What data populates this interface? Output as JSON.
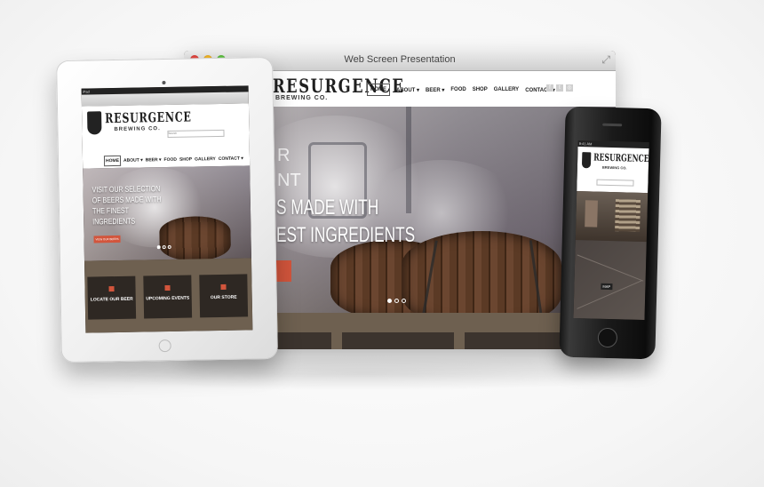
{
  "browser": {
    "window_title": "Web Screen Presentation",
    "traffic_lights": {
      "close": "#e2463f",
      "minimize": "#f0b429",
      "maximize": "#5cbf3f"
    },
    "site": {
      "logo_main": "RESURGENCE",
      "logo_sub": "BREWING CO.",
      "nav": [
        "HOME",
        "ABOUT ▾",
        "BEER ▾",
        "FOOD",
        "SHOP",
        "GALLERY",
        "CONTACT ▾"
      ],
      "social_icons": [
        "facebook-icon",
        "twitter-icon",
        "instagram-icon"
      ],
      "hero": {
        "fragment_1": "R",
        "fragment_2": "NT",
        "line_1": "S MADE WITH",
        "line_2": "EST INGREDIENTS"
      },
      "slider_dots": 3
    }
  },
  "ipad": {
    "status": "iPad",
    "logo_main": "RESURGENCE",
    "logo_sub": "BREWING CO.",
    "search_placeholder": "Search",
    "nav": [
      "HOME",
      "ABOUT ▾",
      "BEER ▾",
      "FOOD",
      "SHOP",
      "GALLERY",
      "CONTACT ▾"
    ],
    "hero_text": "VISIT OUR SELECTION OF BEERS MADE WITH THE FINEST INGREDIENTS",
    "hero_button": "VIEW OUR BEERS",
    "tiles": [
      "LOCATE OUR BEER",
      "UPCOMING EVENTS",
      "OUR STORE"
    ]
  },
  "iphone": {
    "status": "9:41 AM",
    "logo_main": "RESURGENCE",
    "logo_sub": "BREWING CO.",
    "map_label": "MAP"
  },
  "colors": {
    "accent": "#d2553c",
    "band": "#6e6050",
    "dark": "#2c2622"
  }
}
